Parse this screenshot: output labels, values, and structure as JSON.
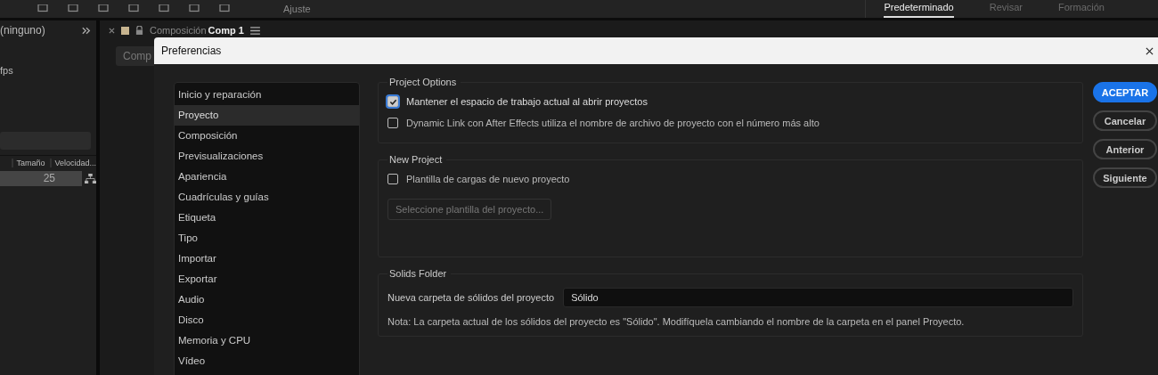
{
  "toolbar": {
    "field_label": "Ajuste",
    "workspaces": [
      {
        "label": "Predeterminado",
        "selected": true
      },
      {
        "label": "Revisar",
        "selected": false
      },
      {
        "label": "Formación",
        "selected": false
      }
    ]
  },
  "project_panel": {
    "title": "(ninguno)",
    "info": "fps",
    "columns": [
      "Tamaño",
      "Velocidad..."
    ],
    "row_value": "25"
  },
  "composition_panel": {
    "label": "Composición",
    "name": "Comp 1",
    "tab": "Comp"
  },
  "dialog": {
    "title": "Preferencias",
    "categories": [
      {
        "label": "Inicio y reparación",
        "selected": false
      },
      {
        "label": "Proyecto",
        "selected": true
      },
      {
        "label": "Composición",
        "selected": false
      },
      {
        "label": "Previsualizaciones",
        "selected": false
      },
      {
        "label": "Apariencia",
        "selected": false
      },
      {
        "label": "Cuadrículas y guías",
        "selected": false
      },
      {
        "label": "Etiqueta",
        "selected": false
      },
      {
        "label": "Tipo",
        "selected": false
      },
      {
        "label": "Importar",
        "selected": false
      },
      {
        "label": "Exportar",
        "selected": false
      },
      {
        "label": "Audio",
        "selected": false
      },
      {
        "label": "Disco",
        "selected": false
      },
      {
        "label": "Memoria y CPU",
        "selected": false
      },
      {
        "label": "Vídeo",
        "selected": false
      }
    ],
    "sections": [
      {
        "title": "Project Options",
        "items": [
          {
            "kind": "checkbox",
            "label": "Mantener el espacio de trabajo actual al abrir proyectos",
            "checked": true,
            "focused": true
          },
          {
            "kind": "checkbox",
            "label": "Dynamic Link con After Effects utiliza el nombre de archivo de proyecto con el número más alto",
            "checked": false,
            "focused": false
          }
        ]
      },
      {
        "title": "New Project",
        "items": [
          {
            "kind": "checkbox",
            "label": "Plantilla de cargas de nuevo proyecto",
            "checked": false,
            "focused": false
          },
          {
            "kind": "button",
            "label": "Seleccione plantilla del proyecto...",
            "disabled": true
          }
        ]
      },
      {
        "title": "Solids Folder",
        "items": [
          {
            "kind": "field",
            "label": "Nueva carpeta de sólidos del proyecto",
            "value": "Sólido"
          },
          {
            "kind": "note",
            "label": "Nota: La carpeta actual de los sólidos del proyecto es \"Sólido\". Modifíquela cambiando el nombre de la carpeta en el panel Proyecto."
          }
        ]
      }
    ],
    "buttons": [
      {
        "label": "ACEPTAR",
        "primary": true
      },
      {
        "label": "Cancelar",
        "primary": false
      },
      {
        "label": "Anterior",
        "primary": false
      },
      {
        "label": "Siguiente",
        "primary": false
      }
    ]
  }
}
